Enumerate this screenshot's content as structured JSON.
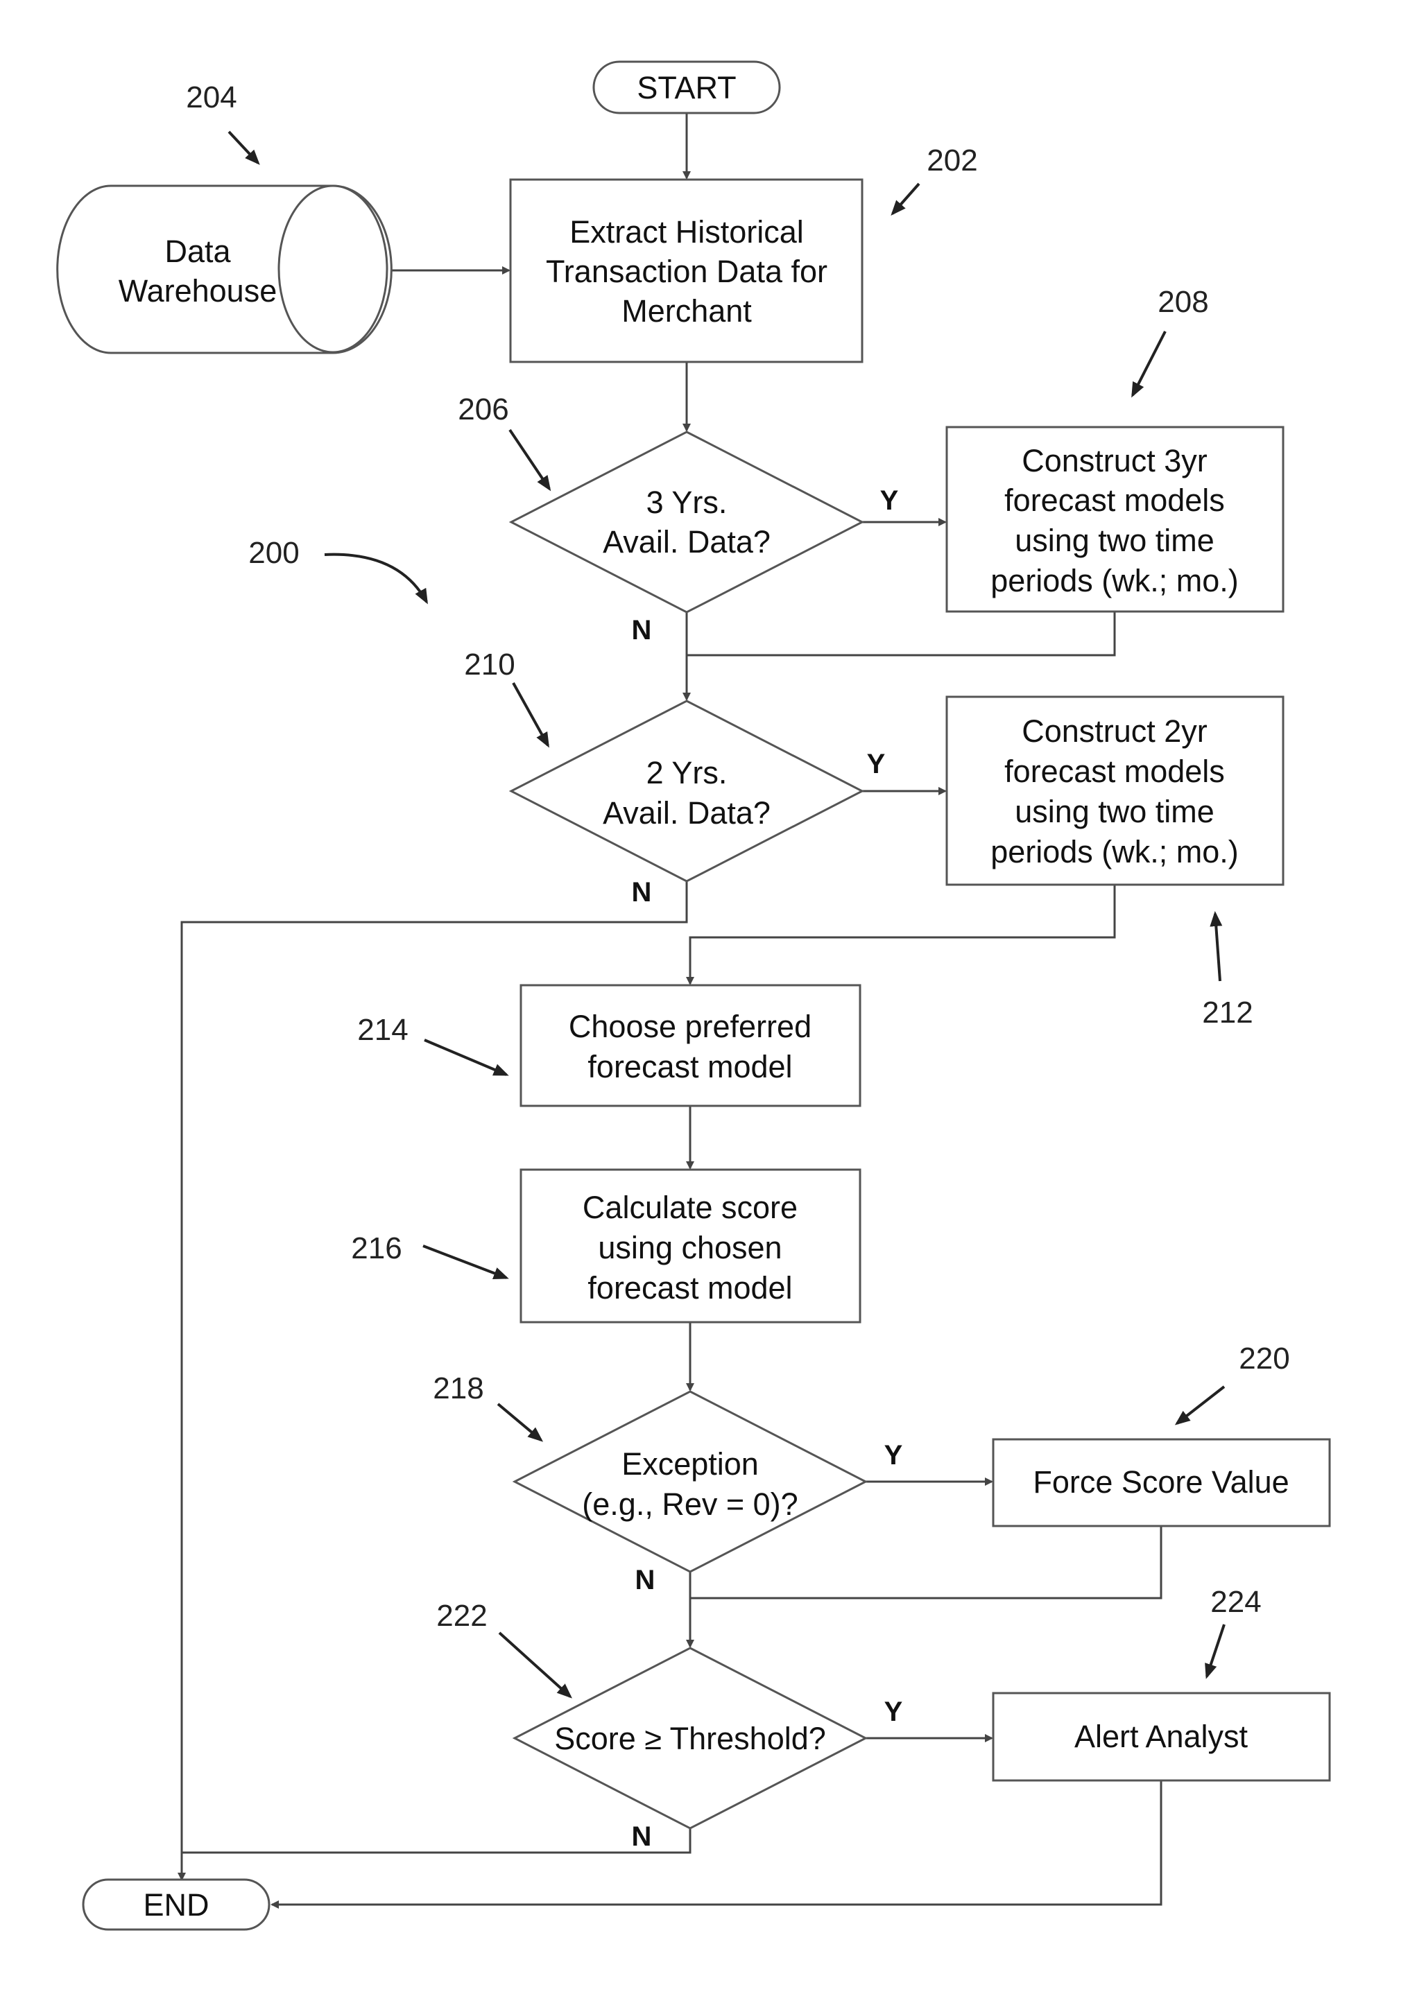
{
  "figure_number": "200",
  "nodes": {
    "start": {
      "label": "START"
    },
    "end": {
      "label": "END"
    },
    "data_warehouse": {
      "ref": "204",
      "lines": [
        "Data",
        "Warehouse"
      ]
    },
    "extract": {
      "ref": "202",
      "lines": [
        "Extract Historical",
        "Transaction Data for",
        "Merchant"
      ]
    },
    "decision_3yr": {
      "ref": "206",
      "lines": [
        "3 Yrs.",
        "Avail. Data?"
      ],
      "yes": "Y",
      "no": "N"
    },
    "construct_3yr": {
      "ref": "208",
      "lines": [
        "Construct 3yr",
        "forecast models",
        "using two time",
        "periods (wk.; mo.)"
      ]
    },
    "decision_2yr": {
      "ref": "210",
      "lines": [
        "2 Yrs.",
        "Avail. Data?"
      ],
      "yes": "Y",
      "no": "N"
    },
    "construct_2yr": {
      "ref": "212",
      "lines": [
        "Construct 2yr",
        "forecast models",
        "using two time",
        "periods (wk.; mo.)"
      ]
    },
    "choose_model": {
      "ref": "214",
      "lines": [
        "Choose preferred",
        "forecast model"
      ]
    },
    "calculate_score": {
      "ref": "216",
      "lines": [
        "Calculate score",
        "using chosen",
        "forecast model"
      ]
    },
    "decision_exception": {
      "ref": "218",
      "lines": [
        "Exception",
        "(e.g., Rev = 0)?"
      ],
      "yes": "Y",
      "no": "N"
    },
    "force_score": {
      "ref": "220",
      "lines": [
        "Force Score Value"
      ]
    },
    "decision_threshold": {
      "ref": "222",
      "lines": [
        "Score ≥ Threshold?"
      ],
      "yes": "Y",
      "no": "N"
    },
    "alert_analyst": {
      "ref": "224",
      "lines": [
        "Alert Analyst"
      ]
    }
  }
}
